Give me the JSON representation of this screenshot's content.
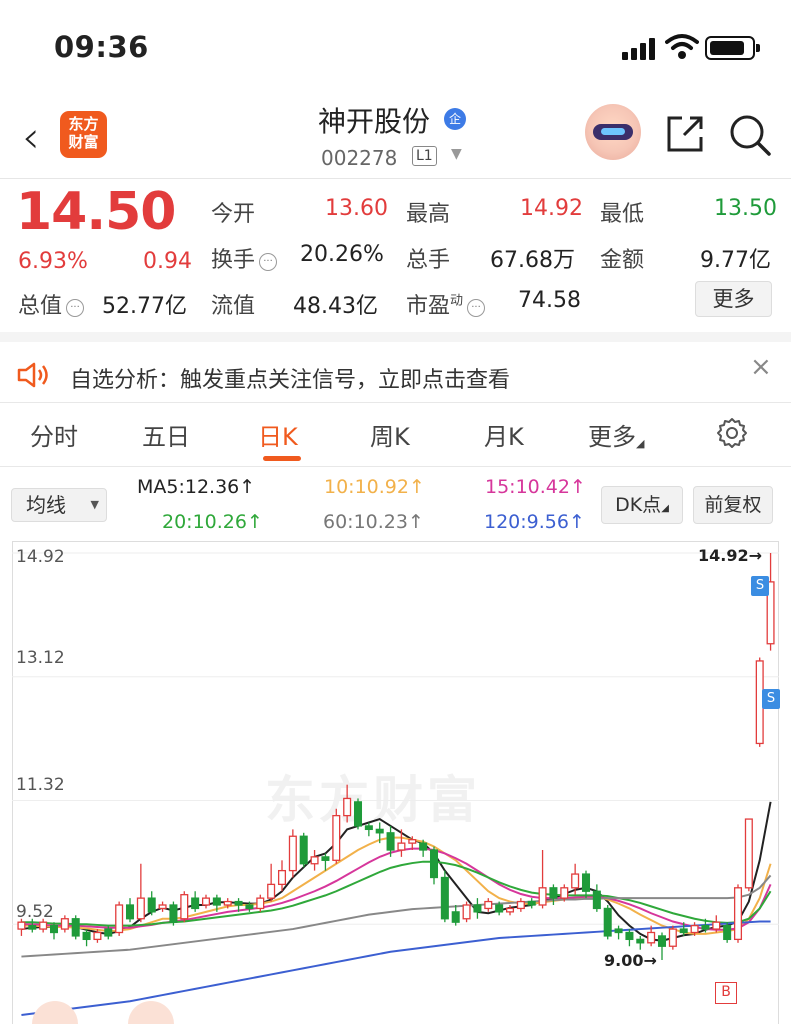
{
  "status_bar": {
    "time": "09:36"
  },
  "header": {
    "logo_text_1": "东方",
    "logo_text_2": "财富",
    "stock_name": "神开股份",
    "badge": "企",
    "stock_code": "002278",
    "level": "L1"
  },
  "quote": {
    "price": "14.50",
    "change_pct": "6.93%",
    "change_amt": "0.94",
    "open_label": "今开",
    "open": "13.60",
    "high_label": "最高",
    "high": "14.92",
    "low_label": "最低",
    "low": "13.50",
    "turnover_label": "换手",
    "turnover": "20.26%",
    "volume_label": "总手",
    "volume": "67.68万",
    "amount_label": "金额",
    "amount": "9.77亿",
    "mktcap_label": "总值",
    "mktcap": "52.77亿",
    "float_label": "流值",
    "float_cap": "48.43亿",
    "pe_label": "市盈",
    "pe_sup": "动",
    "pe": "74.58",
    "more_label": "更多"
  },
  "banner": {
    "text": "自选分析：触发重点关注信号，立即点击查看",
    "close": "×"
  },
  "tabs": [
    {
      "label": "分时"
    },
    {
      "label": "五日"
    },
    {
      "label": "日K"
    },
    {
      "label": "周K"
    },
    {
      "label": "月K"
    },
    {
      "label": "更多"
    }
  ],
  "active_tab": "日K",
  "ma_bar": {
    "selector": "均线",
    "ma5": "MA5:12.36↑",
    "ma10": "10:10.92↑",
    "ma15": "15:10.42↑",
    "ma20": "20:10.26↑",
    "ma60": "60:10.23↑",
    "ma120": "120:9.56↑",
    "dk_btn": "DK点",
    "fq_btn": "前复权"
  },
  "colors": {
    "up": "#e23c3c",
    "down": "#1f9b3a",
    "accent": "#f05a1e",
    "ma5": "#222222",
    "ma10": "#f2b14a",
    "ma15": "#d6369b",
    "ma20": "#2fa83a",
    "ma60": "#888888",
    "ma120": "#3c5fd1"
  },
  "chart_data": {
    "type": "candlestick",
    "y_ticks": [
      "14.92",
      "13.12",
      "11.32",
      "9.52"
    ],
    "ylim": [
      9.0,
      14.92
    ],
    "high_marker": "14.92→",
    "low_marker": "9.00→",
    "watermark": "东方财富",
    "signals": {
      "sell": "S",
      "buy": "B"
    },
    "candles": [
      [
        9.45,
        9.55,
        9.35,
        9.6
      ],
      [
        9.5,
        9.45,
        9.4,
        9.6
      ],
      [
        9.45,
        9.55,
        9.4,
        9.6
      ],
      [
        9.5,
        9.4,
        9.3,
        9.55
      ],
      [
        9.45,
        9.6,
        9.4,
        9.65
      ],
      [
        9.6,
        9.35,
        9.3,
        9.65
      ],
      [
        9.4,
        9.3,
        9.2,
        9.45
      ],
      [
        9.3,
        9.4,
        9.25,
        9.45
      ],
      [
        9.45,
        9.35,
        9.3,
        9.5
      ],
      [
        9.4,
        9.8,
        9.35,
        9.85
      ],
      [
        9.8,
        9.6,
        9.55,
        9.9
      ],
      [
        9.6,
        9.9,
        9.55,
        10.4
      ],
      [
        9.9,
        9.7,
        9.65,
        10.0
      ],
      [
        9.75,
        9.8,
        9.7,
        9.85
      ],
      [
        9.8,
        9.55,
        9.5,
        9.85
      ],
      [
        9.6,
        9.95,
        9.55,
        10.0
      ],
      [
        9.9,
        9.75,
        9.7,
        10.0
      ],
      [
        9.8,
        9.9,
        9.75,
        9.95
      ],
      [
        9.9,
        9.8,
        9.7,
        9.95
      ],
      [
        9.8,
        9.85,
        9.75,
        9.9
      ],
      [
        9.85,
        9.8,
        9.7,
        9.9
      ],
      [
        9.8,
        9.75,
        9.7,
        9.85
      ],
      [
        9.75,
        9.9,
        9.7,
        9.95
      ],
      [
        9.9,
        10.1,
        9.85,
        10.4
      ],
      [
        10.1,
        10.3,
        10.0,
        10.45
      ],
      [
        10.3,
        10.8,
        10.2,
        10.9
      ],
      [
        10.8,
        10.4,
        10.35,
        10.85
      ],
      [
        10.4,
        10.5,
        10.3,
        10.6
      ],
      [
        10.5,
        10.45,
        10.3,
        10.55
      ],
      [
        10.45,
        11.1,
        10.4,
        11.2
      ],
      [
        11.1,
        11.35,
        11.0,
        11.55
      ],
      [
        11.3,
        10.95,
        10.9,
        11.35
      ],
      [
        10.95,
        10.9,
        10.8,
        11.0
      ],
      [
        10.9,
        10.85,
        10.7,
        11.0
      ],
      [
        10.85,
        10.6,
        10.5,
        10.95
      ],
      [
        10.6,
        10.7,
        10.5,
        10.9
      ],
      [
        10.7,
        10.75,
        10.6,
        10.8
      ],
      [
        10.7,
        10.6,
        10.5,
        10.75
      ],
      [
        10.6,
        10.2,
        10.1,
        10.65
      ],
      [
        10.2,
        9.6,
        9.55,
        10.3
      ],
      [
        9.7,
        9.55,
        9.5,
        9.8
      ],
      [
        9.6,
        9.8,
        9.55,
        9.85
      ],
      [
        9.8,
        9.7,
        9.6,
        9.9
      ],
      [
        9.75,
        9.85,
        9.7,
        9.9
      ],
      [
        9.8,
        9.7,
        9.65,
        9.85
      ],
      [
        9.7,
        9.75,
        9.65,
        9.8
      ],
      [
        9.75,
        9.85,
        9.7,
        9.9
      ],
      [
        9.85,
        9.8,
        9.75,
        9.9
      ],
      [
        9.8,
        10.05,
        9.75,
        10.6
      ],
      [
        10.05,
        9.9,
        9.8,
        10.1
      ],
      [
        9.9,
        10.05,
        9.85,
        10.1
      ],
      [
        10.05,
        10.25,
        9.95,
        10.4
      ],
      [
        10.25,
        10.0,
        9.9,
        10.3
      ],
      [
        10.0,
        9.75,
        9.7,
        10.1
      ],
      [
        9.75,
        9.35,
        9.3,
        9.8
      ],
      [
        9.45,
        9.4,
        9.3,
        9.5
      ],
      [
        9.4,
        9.3,
        9.2,
        9.45
      ],
      [
        9.3,
        9.25,
        9.15,
        9.35
      ],
      [
        9.25,
        9.4,
        9.2,
        9.5
      ],
      [
        9.35,
        9.2,
        9.0,
        9.4
      ],
      [
        9.2,
        9.45,
        9.15,
        9.5
      ],
      [
        9.45,
        9.4,
        9.35,
        9.55
      ],
      [
        9.4,
        9.5,
        9.35,
        9.55
      ],
      [
        9.5,
        9.45,
        9.4,
        9.6
      ],
      [
        9.45,
        9.55,
        9.4,
        9.65
      ],
      [
        9.5,
        9.3,
        9.25,
        9.55
      ],
      [
        9.3,
        10.05,
        9.25,
        10.1
      ],
      [
        10.05,
        11.05,
        10.0,
        11.05
      ],
      [
        12.15,
        13.35,
        12.1,
        13.4
      ],
      [
        13.6,
        14.5,
        13.5,
        14.92
      ]
    ],
    "ma_series": [
      {
        "name": "MA5",
        "values": [
          9.45,
          9.47,
          9.48,
          9.48,
          9.5,
          9.48,
          9.44,
          9.4,
          9.38,
          9.42,
          9.48,
          9.6,
          9.7,
          9.76,
          9.72,
          9.76,
          9.8,
          9.8,
          9.84,
          9.84,
          9.83,
          9.82,
          9.82,
          9.88,
          10.0,
          10.2,
          10.35,
          10.5,
          10.55,
          10.7,
          10.9,
          10.95,
          11.0,
          11.05,
          10.95,
          10.85,
          10.75,
          10.7,
          10.55,
          10.3,
          10.1,
          9.9,
          9.7,
          9.68,
          9.72,
          9.76,
          9.78,
          9.8,
          9.86,
          9.9,
          9.96,
          10.02,
          10.05,
          10.0,
          9.85,
          9.65,
          9.5,
          9.38,
          9.3,
          9.28,
          9.32,
          9.36,
          9.38,
          9.44,
          9.48,
          9.5,
          9.56,
          9.85,
          10.45,
          11.3
        ]
      },
      {
        "name": "MA10",
        "values": [
          9.5,
          9.5,
          9.49,
          9.48,
          9.48,
          9.47,
          9.46,
          9.44,
          9.42,
          9.43,
          9.45,
          9.5,
          9.55,
          9.6,
          9.6,
          9.62,
          9.66,
          9.7,
          9.74,
          9.78,
          9.8,
          9.8,
          9.82,
          9.85,
          9.9,
          10.0,
          10.1,
          10.2,
          10.3,
          10.4,
          10.5,
          10.6,
          10.68,
          10.75,
          10.78,
          10.78,
          10.75,
          10.72,
          10.65,
          10.55,
          10.45,
          10.3,
          10.15,
          10.0,
          9.9,
          9.85,
          9.82,
          9.82,
          9.84,
          9.86,
          9.88,
          9.9,
          9.92,
          9.92,
          9.88,
          9.82,
          9.75,
          9.66,
          9.58,
          9.5,
          9.45,
          9.4,
          9.38,
          9.38,
          9.4,
          9.42,
          9.45,
          9.6,
          9.9,
          10.4
        ]
      },
      {
        "name": "MA15",
        "values": [
          9.52,
          9.52,
          9.51,
          9.5,
          9.5,
          9.5,
          9.49,
          9.48,
          9.47,
          9.47,
          9.47,
          9.49,
          9.51,
          9.54,
          9.56,
          9.58,
          9.61,
          9.64,
          9.67,
          9.7,
          9.72,
          9.74,
          9.76,
          9.79,
          9.83,
          9.88,
          9.94,
          10.0,
          10.07,
          10.15,
          10.24,
          10.33,
          10.42,
          10.5,
          10.56,
          10.6,
          10.62,
          10.62,
          10.6,
          10.55,
          10.48,
          10.4,
          10.3,
          10.2,
          10.1,
          10.02,
          9.96,
          9.92,
          9.9,
          9.9,
          9.9,
          9.91,
          9.92,
          9.92,
          9.9,
          9.86,
          9.81,
          9.75,
          9.68,
          9.62,
          9.56,
          9.52,
          9.48,
          9.45,
          9.44,
          9.44,
          9.46,
          9.55,
          9.75,
          10.1
        ]
      },
      {
        "name": "MA20",
        "values": [
          9.55,
          9.55,
          9.54,
          9.53,
          9.53,
          9.52,
          9.52,
          9.51,
          9.5,
          9.5,
          9.5,
          9.51,
          9.52,
          9.54,
          9.55,
          9.56,
          9.58,
          9.6,
          9.62,
          9.64,
          9.66,
          9.68,
          9.7,
          9.72,
          9.75,
          9.79,
          9.84,
          9.89,
          9.94,
          10.0,
          10.07,
          10.14,
          10.21,
          10.28,
          10.34,
          10.38,
          10.41,
          10.43,
          10.43,
          10.41,
          10.38,
          10.33,
          10.27,
          10.2,
          10.13,
          10.07,
          10.02,
          9.98,
          9.96,
          9.95,
          9.94,
          9.94,
          9.94,
          9.94,
          9.93,
          9.9,
          9.87,
          9.83,
          9.78,
          9.73,
          9.68,
          9.64,
          9.6,
          9.57,
          9.55,
          9.54,
          9.55,
          9.6,
          9.75,
          10.0
        ]
      },
      {
        "name": "MA60",
        "values": [
          9.05,
          9.06,
          9.07,
          9.08,
          9.09,
          9.1,
          9.11,
          9.12,
          9.13,
          9.14,
          9.15,
          9.17,
          9.19,
          9.21,
          9.23,
          9.25,
          9.27,
          9.29,
          9.31,
          9.33,
          9.35,
          9.37,
          9.39,
          9.41,
          9.43,
          9.45,
          9.48,
          9.51,
          9.54,
          9.57,
          9.6,
          9.63,
          9.66,
          9.68,
          9.7,
          9.72,
          9.74,
          9.75,
          9.76,
          9.77,
          9.78,
          9.79,
          9.8,
          9.81,
          9.82,
          9.83,
          9.84,
          9.85,
          9.86,
          9.87,
          9.88,
          9.88,
          9.89,
          9.89,
          9.9,
          9.9,
          9.9,
          9.9,
          9.9,
          9.9,
          9.9,
          9.9,
          9.9,
          9.9,
          9.9,
          9.9,
          9.91,
          9.95,
          10.05,
          10.23
        ]
      },
      {
        "name": "MA120",
        "values": [
          8.2,
          8.22,
          8.24,
          8.26,
          8.28,
          8.3,
          8.32,
          8.34,
          8.36,
          8.38,
          8.4,
          8.43,
          8.46,
          8.49,
          8.52,
          8.55,
          8.58,
          8.61,
          8.64,
          8.67,
          8.7,
          8.73,
          8.76,
          8.79,
          8.82,
          8.85,
          8.88,
          8.91,
          8.94,
          8.97,
          9.0,
          9.03,
          9.06,
          9.09,
          9.12,
          9.14,
          9.16,
          9.18,
          9.2,
          9.22,
          9.24,
          9.26,
          9.28,
          9.3,
          9.32,
          9.33,
          9.34,
          9.35,
          9.36,
          9.37,
          9.38,
          9.39,
          9.4,
          9.41,
          9.42,
          9.43,
          9.44,
          9.45,
          9.46,
          9.47,
          9.48,
          9.49,
          9.5,
          9.51,
          9.52,
          9.53,
          9.54,
          9.55,
          9.56,
          9.56
        ]
      }
    ]
  }
}
